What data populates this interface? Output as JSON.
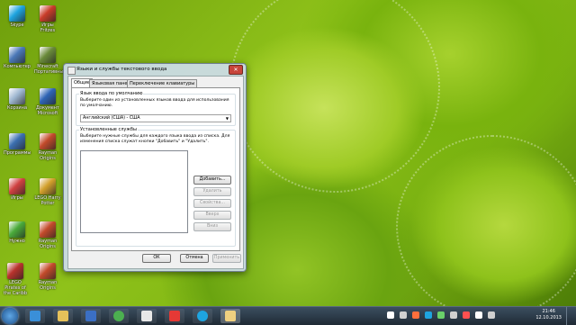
{
  "desktop": {
    "icons": [
      {
        "label": "Skype",
        "color": "#1ea4e0"
      },
      {
        "label": "Игры Fritzes",
        "color": "#c93d2a"
      },
      {
        "label": "Компьютер",
        "color": "#4a78b8"
      },
      {
        "label": "Minecraft Портативный",
        "color": "#6a8a3a"
      },
      {
        "label": "Корзина",
        "color": "#9fb7d1"
      },
      {
        "label": "Документ Microsoft",
        "color": "#2f64b5"
      },
      {
        "label": "Программы",
        "color": "#3c6fb0"
      },
      {
        "label": "Rayman Origins",
        "color": "#c34b2b"
      },
      {
        "label": "Игры",
        "color": "#d04040"
      },
      {
        "label": "LEGO Harry Potter",
        "color": "#d3a02b"
      },
      {
        "label": "Нужно",
        "color": "#4aaa3a"
      },
      {
        "label": "Rayman Origins",
        "color": "#c34b2b"
      },
      {
        "label": "LEGO Pirates of the Caribb",
        "color": "#b8322c"
      },
      {
        "label": "Rayman Origins",
        "color": "#c34b2b"
      }
    ]
  },
  "dialog": {
    "title": "Языки и службы текстового ввода",
    "close_label": "✕",
    "tabs": [
      "Общие",
      "Языковая панель",
      "Переключение клавиатуры"
    ],
    "default_language": {
      "group_label": "Язык ввода по умолчанию",
      "description": "Выберите один из установленных языков ввода для использования по умолчанию.",
      "selected": "Английский (США) - США"
    },
    "installed_services": {
      "group_label": "Установленные службы",
      "description": "Выберите нужные службы для каждого языка ввода из списка. Для изменения списка служат кнопки \"Добавить\" и \"Удалить\".",
      "buttons": {
        "add": "Добавить...",
        "remove": "Удалить",
        "properties": "Свойства...",
        "up": "Вверх",
        "down": "Вниз"
      }
    },
    "footer": {
      "ok": "ОК",
      "cancel": "Отмена",
      "apply": "Применить"
    }
  },
  "taskbar": {
    "items": [
      {
        "icon": "ie-icon",
        "color": "#3a8fd8"
      },
      {
        "icon": "folder-icon",
        "color": "#e6c15a"
      },
      {
        "icon": "media-player-icon",
        "color": "#3b6fc4"
      },
      {
        "icon": "chrome-icon",
        "color": "#4caf50"
      },
      {
        "icon": "document-icon",
        "color": "#e8e8e8"
      },
      {
        "icon": "yandex-icon",
        "color": "#e53935"
      },
      {
        "icon": "skype-icon",
        "color": "#1ea4e0"
      },
      {
        "icon": "language-settings-icon",
        "color": "#f0d080"
      }
    ],
    "tray_colors": [
      "#ffffff",
      "#d0d0d0",
      "#ff6f3c",
      "#1ea4e0",
      "#6ad06a",
      "#d0d0d0",
      "#ff5050",
      "#ffffff",
      "#d0d0d0"
    ],
    "time": "21:46",
    "date": "12.10.2013"
  }
}
